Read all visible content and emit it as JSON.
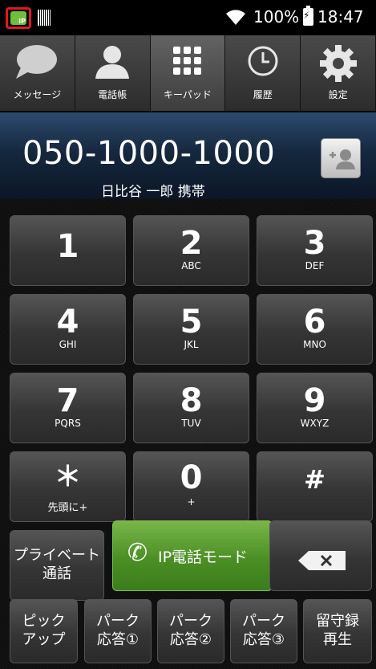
{
  "status": {
    "battery": "100%",
    "time": "18:47",
    "ip_badge_text": "IP"
  },
  "tabs": [
    {
      "label": "メッセージ",
      "icon": "speech-bubble-icon"
    },
    {
      "label": "電話帳",
      "icon": "person-icon"
    },
    {
      "label": "キーパッド",
      "icon": "keypad-icon"
    },
    {
      "label": "履歴",
      "icon": "clock-icon"
    },
    {
      "label": "設定",
      "icon": "gear-icon"
    }
  ],
  "display": {
    "number": "050-1000-1000",
    "caller": "日比谷 一郎 携帯"
  },
  "keys": [
    {
      "digit": "1",
      "letters": ""
    },
    {
      "digit": "2",
      "letters": "ABC"
    },
    {
      "digit": "3",
      "letters": "DEF"
    },
    {
      "digit": "4",
      "letters": "GHI"
    },
    {
      "digit": "5",
      "letters": "JKL"
    },
    {
      "digit": "6",
      "letters": "MNO"
    },
    {
      "digit": "7",
      "letters": "PQRS"
    },
    {
      "digit": "8",
      "letters": "TUV"
    },
    {
      "digit": "9",
      "letters": "WXYZ"
    },
    {
      "digit": "＊",
      "letters": "先頭に+"
    },
    {
      "digit": "0",
      "letters": "+"
    },
    {
      "digit": "#",
      "letters": ""
    }
  ],
  "actions": {
    "private_call_line1": "プライベート",
    "private_call_line2": "通話",
    "ip_call_mode": "IP電話モード"
  },
  "bottom_buttons": [
    {
      "line1": "ピック",
      "line2": "アップ"
    },
    {
      "line1": "パーク",
      "line2": "応答①"
    },
    {
      "line1": "パーク",
      "line2": "応答②"
    },
    {
      "line1": "パーク",
      "line2": "応答③"
    },
    {
      "line1": "留守録",
      "line2": "再生"
    }
  ],
  "colors": {
    "ip_highlight": "#e0191f",
    "call_green": "#4a8f24",
    "display_blue": "#1f3a5c"
  }
}
